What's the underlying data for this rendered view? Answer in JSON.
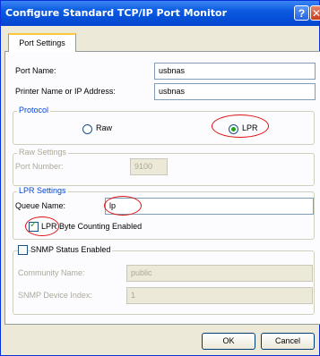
{
  "window": {
    "title": "Configure Standard TCP/IP Port Monitor",
    "help_glyph": "?",
    "close_glyph": "✕"
  },
  "tab": {
    "label": "Port Settings"
  },
  "port_name": {
    "label": "Port Name:",
    "value": "usbnas"
  },
  "printer_address": {
    "label": "Printer Name or IP Address:",
    "value": "usbnas"
  },
  "protocol": {
    "group_label": "Protocol",
    "raw_label": "Raw",
    "lpr_label": "LPR",
    "selected": "LPR"
  },
  "raw_settings": {
    "group_label": "Raw Settings",
    "port_number_label": "Port Number:",
    "port_number_value": "9100"
  },
  "lpr_settings": {
    "group_label": "LPR Settings",
    "queue_name_label": "Queue Name:",
    "queue_name_value": "lp",
    "byte_counting_label": "LPR Byte Counting Enabled",
    "byte_counting_checked": true
  },
  "snmp": {
    "label": "SNMP Status Enabled",
    "checked": false,
    "community_label": "Community Name:",
    "community_value": "public",
    "device_index_label": "SNMP Device Index:",
    "device_index_value": "1"
  },
  "buttons": {
    "ok": "OK",
    "cancel": "Cancel"
  },
  "colors": {
    "annotation": "#e01010",
    "titlebar": "#0b5ae0",
    "accent_green": "#21a121"
  }
}
